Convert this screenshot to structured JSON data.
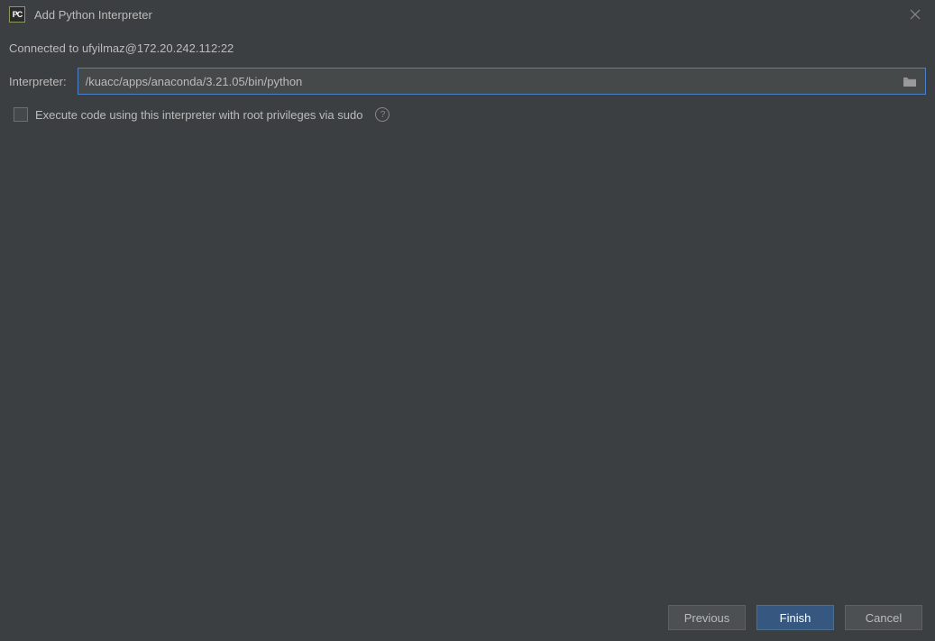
{
  "titlebar": {
    "app_icon_text": "PC",
    "title": "Add Python Interpreter"
  },
  "connection": {
    "text": "Connected to ufyilmaz@172.20.242.112:22"
  },
  "interpreter": {
    "label": "Interpreter:",
    "value": "/kuacc/apps/anaconda/3.21.05/bin/python"
  },
  "checkbox": {
    "label": "Execute code using this interpreter with root privileges via sudo"
  },
  "buttons": {
    "previous": "Previous",
    "finish": "Finish",
    "cancel": "Cancel"
  }
}
